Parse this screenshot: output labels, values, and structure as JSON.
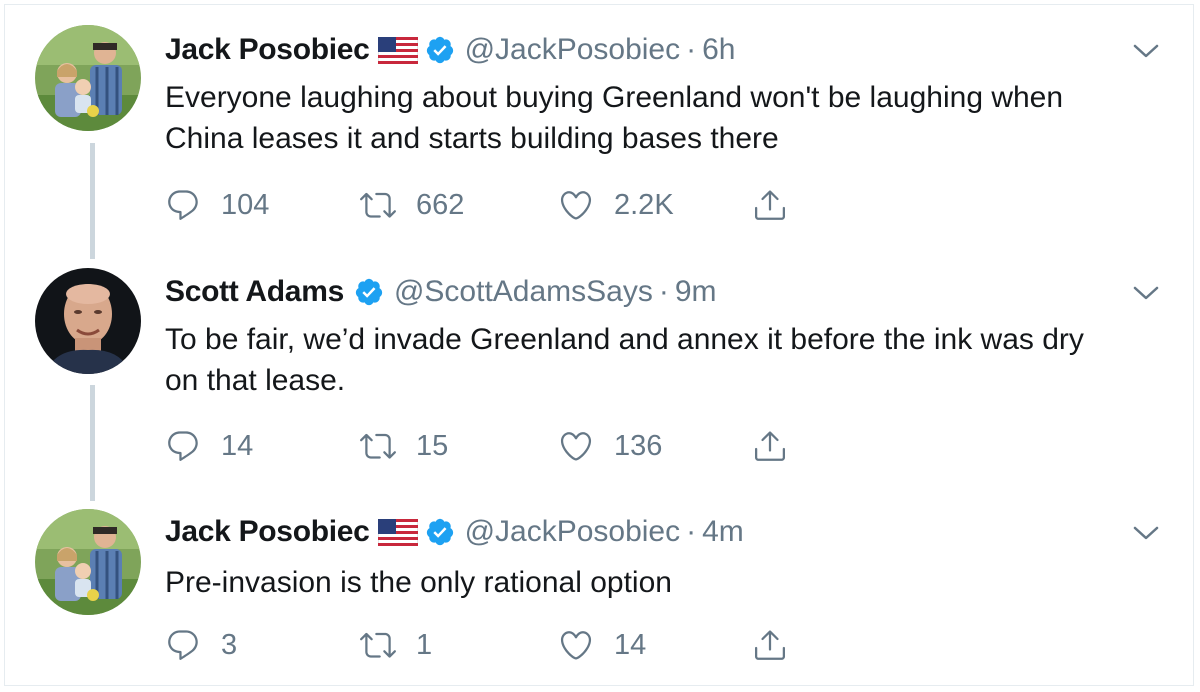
{
  "tweets": [
    {
      "name": "Jack Posobiec",
      "has_flag": true,
      "handle": "@JackPosobiec",
      "separator": "·",
      "time": "6h",
      "text": "Everyone laughing about buying Greenland won't be laughing when China leases it and starts building bases there",
      "text_line1": "Everyone laughing about buying Greenland won't be laughing when",
      "text_line2": "China leases it and starts building bases there",
      "replies": "104",
      "retweets": "662",
      "likes": "2.2K"
    },
    {
      "name": "Scott Adams",
      "has_flag": false,
      "handle": "@ScottAdamsSays",
      "separator": "·",
      "time": "9m",
      "text_line1": "To be fair, we’d invade Greenland and annex it before the ink was dry",
      "text_line2": "on that lease.",
      "replies": "14",
      "retweets": "15",
      "likes": "136"
    },
    {
      "name": "Jack Posobiec",
      "has_flag": true,
      "handle": "@JackPosobiec",
      "separator": "·",
      "time": "4m",
      "text_line1": "Pre-invasion is the only rational option",
      "replies": "3",
      "retweets": "1",
      "likes": "14"
    }
  ],
  "icons": {
    "reply": "reply-icon",
    "retweet": "retweet-icon",
    "like": "heart-icon",
    "share": "share-icon",
    "verified": "verified-badge-icon",
    "flag": "us-flag-icon",
    "menu": "chevron-down-icon"
  },
  "colors": {
    "verified": "#1da1f2",
    "secondary_text": "#657786",
    "thread_line": "#ccd6dd",
    "primary_text": "#14171a"
  }
}
